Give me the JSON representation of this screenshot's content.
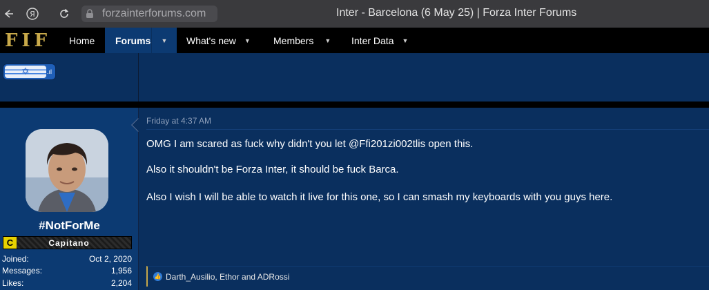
{
  "browser": {
    "back_icon": "back-arrow-icon",
    "yandex_icon": "yandex-icon",
    "reload_icon": "reload-icon",
    "lock_icon": "lock-icon",
    "url": "forzainterforums.com",
    "tab_title": "Inter - Barcelona (6 May 25) | Forza Inter Forums"
  },
  "nav": {
    "logo": "FIF",
    "items": [
      {
        "label": "Home"
      },
      {
        "label": "Forums"
      },
      {
        "label": "What's new"
      },
      {
        "label": "Members"
      },
      {
        "label": "Inter Data"
      }
    ]
  },
  "prev_post": {
    "flag_suffix": ".ıl",
    "flag_icon": "israel-flag-banner-icon"
  },
  "post": {
    "date": "Friday at 4:37 AM",
    "username": "#NotForMe",
    "rank_letter": "C",
    "rank_title": "Capitano",
    "stats": [
      {
        "label": "Joined:",
        "value": "Oct 2, 2020"
      },
      {
        "label": "Messages:",
        "value": "1,956"
      },
      {
        "label": "Likes:",
        "value": "2,204"
      }
    ],
    "lines": [
      "OMG I am scared as fuck why didn't you let @Ffi201zi002tlis open this.",
      "Also it shouldn't be Forza Inter, it should be fuck Barca.",
      "Also I wish I will be able to watch it live for this one, so I can smash my keyboards with you guys here."
    ],
    "reactions": "Darth_Ausilio, Ethor and ADRossi"
  },
  "colors": {
    "page_bg": "#0c2d5a",
    "nav_bg": "#000000",
    "accent_gold": "#c8a94a",
    "active_tab": "#0c3a72"
  }
}
